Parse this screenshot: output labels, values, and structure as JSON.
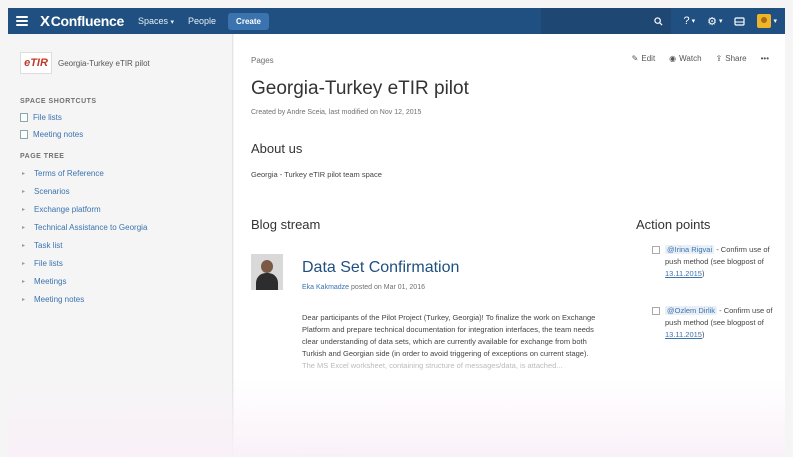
{
  "topnav": {
    "logo": "Confluence",
    "logo_mark": "X",
    "spaces": "Spaces",
    "people": "People",
    "create": "Create"
  },
  "sidebar": {
    "space_logo": "eTIR",
    "space_name": "Georgia-Turkey eTIR pilot",
    "shortcuts_title": "SPACE SHORTCUTS",
    "shortcuts": [
      {
        "label": "File lists"
      },
      {
        "label": "Meeting notes"
      }
    ],
    "tree_title": "PAGE TREE",
    "tree": [
      {
        "label": "Terms of Reference"
      },
      {
        "label": "Scenarios"
      },
      {
        "label": "Exchange platform"
      },
      {
        "label": "Technical Assistance to Georgia"
      },
      {
        "label": "Task list"
      },
      {
        "label": "File lists"
      },
      {
        "label": "Meetings"
      },
      {
        "label": "Meeting notes"
      }
    ]
  },
  "page": {
    "breadcrumb": "Pages",
    "actions": {
      "edit": "Edit",
      "watch": "Watch",
      "share": "Share",
      "more": "•••"
    },
    "title": "Georgia-Turkey eTIR pilot",
    "byline": "Created by Andre Sceia, last modified on Nov 12, 2015",
    "about_heading": "About us",
    "about_text": "Georgia - Turkey eTIR pilot team space",
    "blog_heading": "Blog stream",
    "post": {
      "title": "Data Set Confirmation",
      "author": "Eka Kakmadze",
      "meta_suffix": " posted on Mar 01, 2016",
      "body": "Dear participants of the Pilot Project (Turkey, Georgia)! To finalize the work on Exchange Platform and prepare technical documentation for integration interfaces, the team needs clear understanding of data sets, which are currently available for exchange from both Turkish and Georgian side (in order to avoid triggering of exceptions on current stage).",
      "body_fade": "The MS Excel worksheet, containing structure of messages/data, is attached..."
    },
    "action_heading": "Action points",
    "tasks": [
      {
        "mention": "@Irina Rigvai",
        "text": " - Confirm use of push method (see blogpost of ",
        "date": "13.11.2015",
        "end": ")"
      },
      {
        "mention": "@Ozlem Dirlik",
        "text": " - Confirm use of push method (see blogpost of ",
        "date": "13.11.2015",
        "end": ")"
      }
    ]
  }
}
